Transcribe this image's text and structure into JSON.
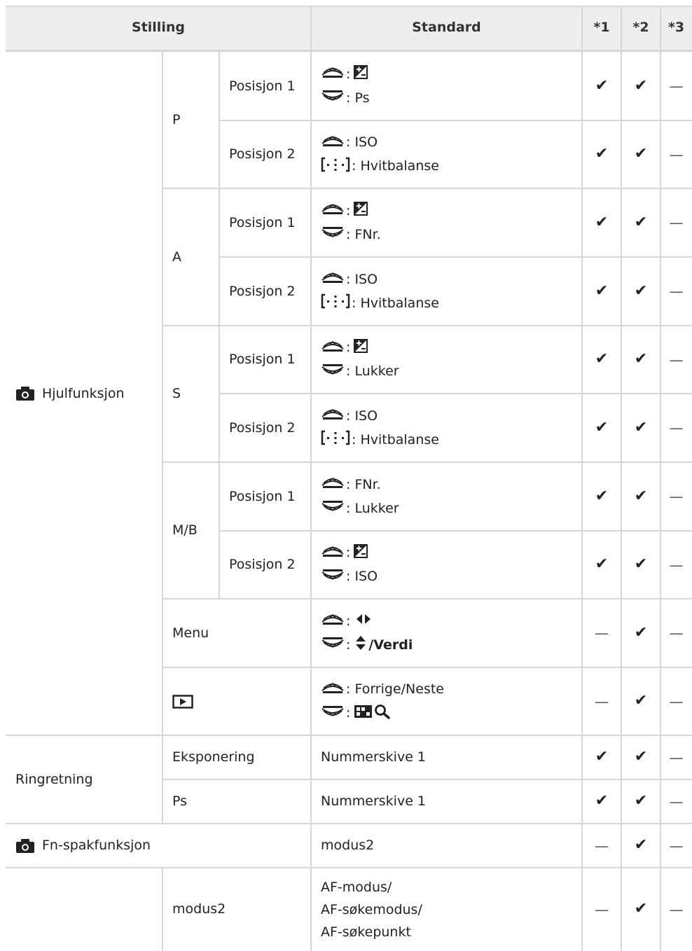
{
  "header": {
    "col_stilling": "Stilling",
    "col_standard": "Standard",
    "col_1": "*1",
    "col_2": "*2",
    "col_3": "*3"
  },
  "marks": {
    "check": "✔",
    "dash": "—"
  },
  "icons": {
    "front_dial": "front-dial-icon",
    "rear_dial": "rear-dial-icon",
    "af_target": "af-target-icon",
    "exposure_comp": "exposure-compensation-icon",
    "camera": "camera-icon",
    "playback": "playback-icon",
    "left_right": "left-right-arrows-icon",
    "up_down": "up-down-arrows-icon",
    "index": "index-view-icon",
    "magnify": "magnify-icon"
  },
  "rows": {
    "hjul": "Hjulfunksjon",
    "p": "P",
    "a": "A",
    "s": "S",
    "mb": "M/B",
    "menu": "Menu",
    "pos1": "Posisjon 1",
    "pos2": "Posisjon 2",
    "ps_text": ": Ps",
    "iso_text": ": ISO",
    "wb_text": ": Hvitbalanse",
    "fnr_text": ": FNr.",
    "lukker_text": ": Lukker",
    "colon": ":",
    "verdi_text": "/Verdi",
    "forrige_text": ": Forrige/Neste",
    "ringretning": "Ringretning",
    "eksponering": "Eksponering",
    "ps": "Ps",
    "nummerskive": "Nummerskive 1",
    "fn_spak": "Fn-spakfunksjon",
    "modus2": "modus2",
    "af_line1": "AF-modus/",
    "af_line2": "AF-søkemodus/",
    "af_line3": "AF-søkepunkt"
  }
}
